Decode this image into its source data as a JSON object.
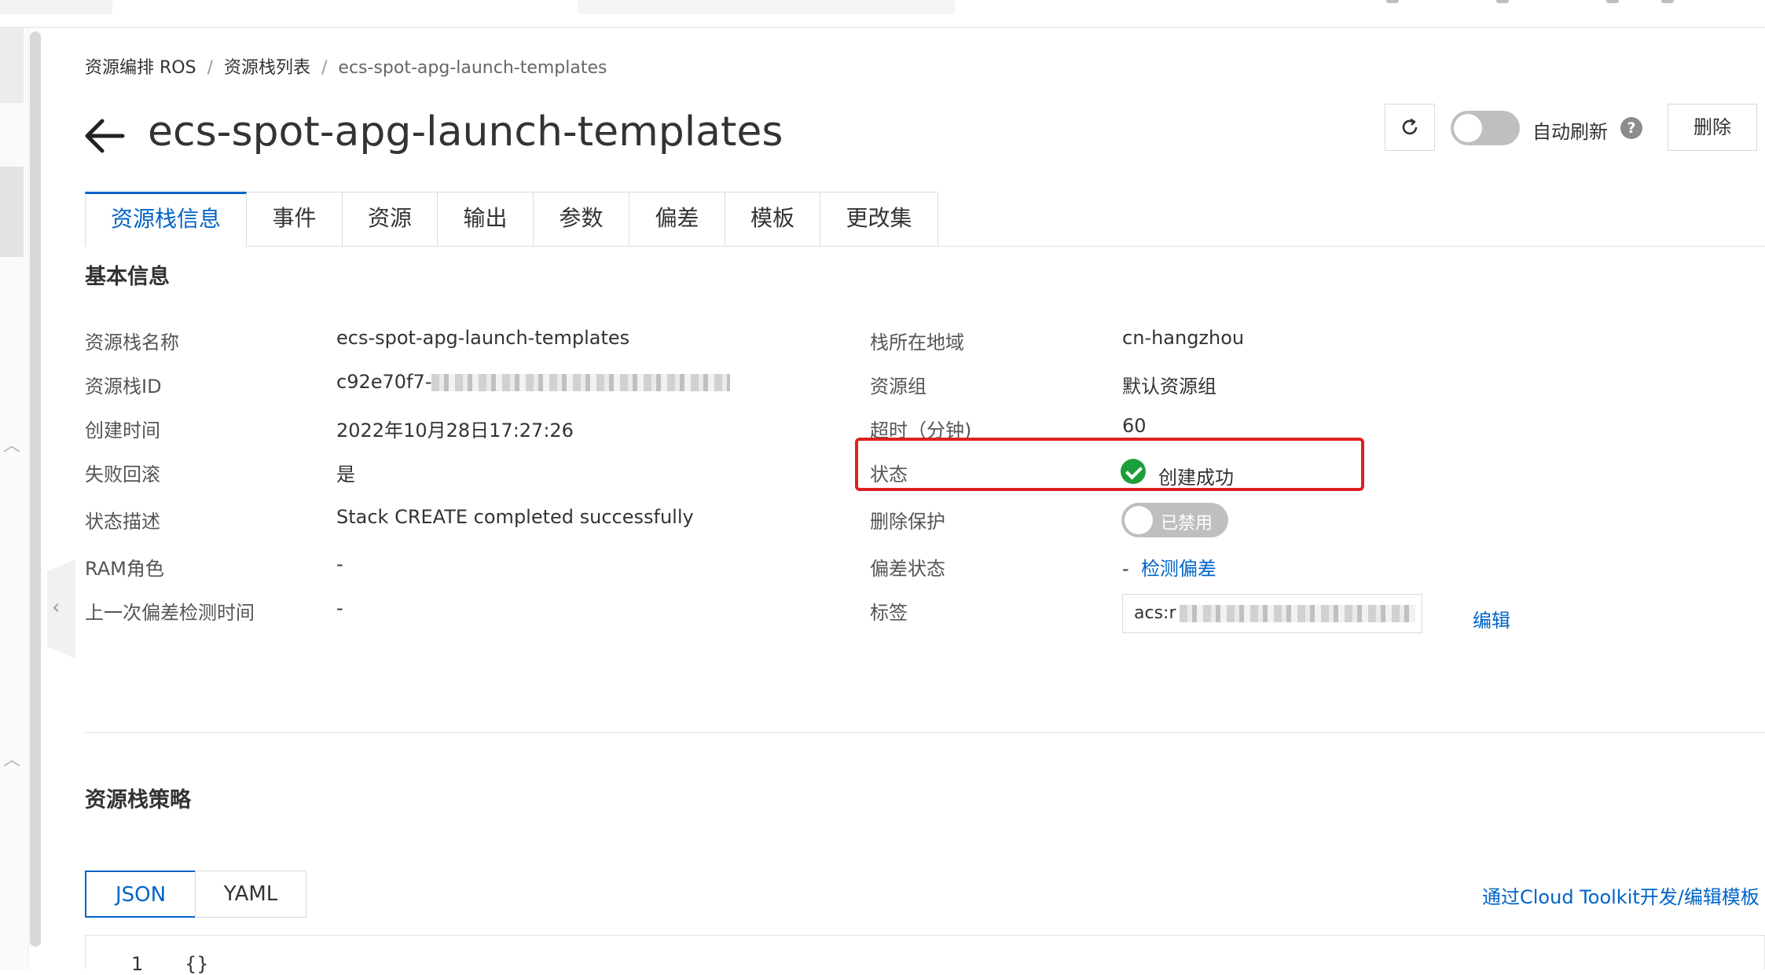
{
  "breadcrumb": [
    "资源编排 ROS",
    "资源栈列表",
    "ecs-spot-apg-launch-templates"
  ],
  "page_title": "ecs-spot-apg-launch-templates",
  "header": {
    "auto_refresh_label": "自动刷新",
    "help_glyph": "?",
    "delete_label": "删除",
    "auto_refresh_on": false
  },
  "tabs": [
    "资源栈信息",
    "事件",
    "资源",
    "输出",
    "参数",
    "偏差",
    "模板",
    "更改集"
  ],
  "active_tab": "资源栈信息",
  "basic": {
    "title": "基本信息",
    "left": [
      {
        "label": "资源栈名称",
        "value": "ecs-spot-apg-launch-templates"
      },
      {
        "label": "资源栈ID",
        "value": "c92e70f7-"
      },
      {
        "label": "创建时间",
        "value": "2022年10月28日17:27:26"
      },
      {
        "label": "失败回滚",
        "value": "是"
      },
      {
        "label": "状态描述",
        "value": "Stack CREATE completed successfully"
      },
      {
        "label": "RAM角色",
        "value": "-"
      },
      {
        "label": "上一次偏差检测时间",
        "value": "-"
      }
    ],
    "right": {
      "region_label": "栈所在地域",
      "region_value": "cn-hangzhou",
      "group_label": "资源组",
      "group_value": "默认资源组",
      "timeout_label": "超时（分钟)",
      "timeout_value": "60",
      "status_label": "状态",
      "status_value": "创建成功",
      "protect_label": "删除保护",
      "protect_value": "已禁用",
      "drift_label": "偏差状态",
      "drift_prefix": "-",
      "drift_link": "检测偏差",
      "tags_label": "标签",
      "tags_value": "acs:r",
      "tags_edit": "编辑"
    }
  },
  "policy": {
    "title": "资源栈策略",
    "format_json": "JSON",
    "format_yaml": "YAML",
    "selected_format": "JSON",
    "toolkit_link": "通过Cloud Toolkit开发/编辑模板",
    "line_number": "1",
    "code": "{}"
  },
  "colors": {
    "accent": "#0064c8",
    "success": "#1e9e3a",
    "highlight": "#e02020"
  }
}
